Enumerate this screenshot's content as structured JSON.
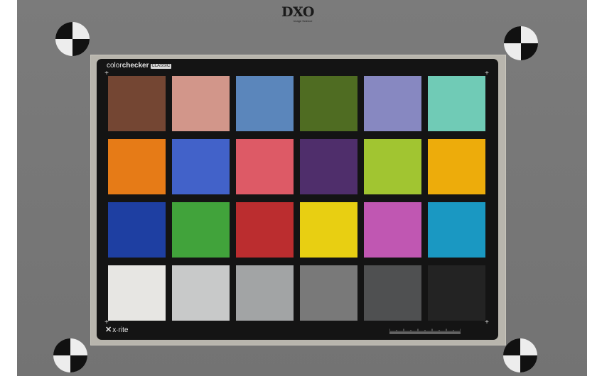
{
  "logo": {
    "text": "DXO",
    "tagline": "Image Science"
  },
  "chart": {
    "brand_light": "color",
    "brand_bold": "checker",
    "brand_tag": "CLASSIC",
    "maker": "x·rite",
    "patch_colors": [
      [
        "#744633",
        "#d2968a",
        "#5b86bb",
        "#4f6c22",
        "#8788c1",
        "#70cbb6"
      ],
      [
        "#e67b17",
        "#4262c9",
        "#dd5a66",
        "#4f2e6b",
        "#a1c531",
        "#edac0b"
      ],
      [
        "#1e3fa2",
        "#41a33b",
        "#bb2d2f",
        "#e8cf12",
        "#c057b2",
        "#1a98c2"
      ],
      [
        "#e7e6e3",
        "#c8c9c9",
        "#a2a4a5",
        "#797979",
        "#4f5051",
        "#232323"
      ]
    ]
  }
}
